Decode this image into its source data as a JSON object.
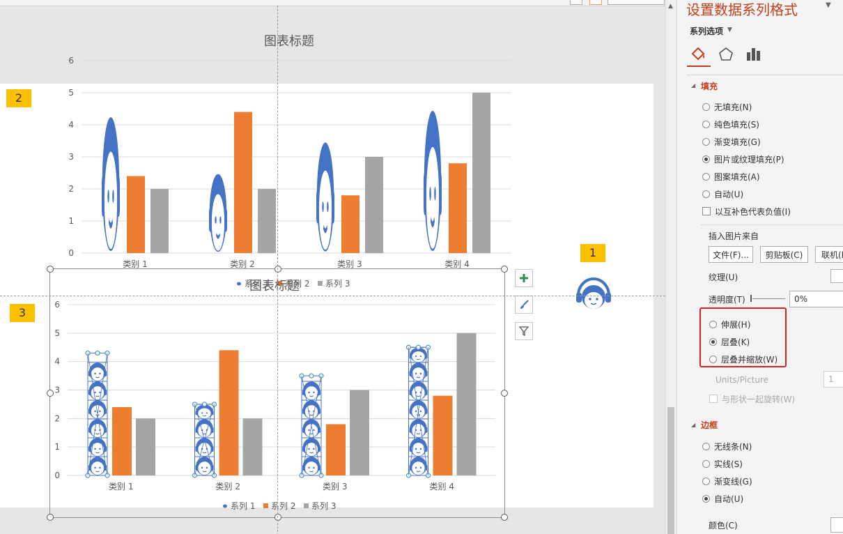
{
  "slide": {
    "tags": [
      "1",
      "2",
      "3"
    ]
  },
  "chart_data": [
    {
      "type": "bar",
      "title": "图表标题",
      "categories": [
        "类别 1",
        "类别 2",
        "类别 3",
        "类别 4"
      ],
      "series": [
        {
          "name": "系列 1",
          "values": [
            4.3,
            2.5,
            3.5,
            4.5
          ],
          "fill": "stretched picture (girl head)"
        },
        {
          "name": "系列 2",
          "values": [
            2.4,
            4.4,
            1.8,
            2.8
          ]
        },
        {
          "name": "系列 3",
          "values": [
            2,
            2,
            3,
            5
          ]
        }
      ],
      "yticks": [
        "0",
        "1",
        "2",
        "3",
        "4",
        "5",
        "6"
      ],
      "ylim": [
        0,
        6
      ],
      "grid": true,
      "legend": "bottom",
      "colors": [
        "#4472c4",
        "#ed7d31",
        "#a5a5a5"
      ]
    },
    {
      "type": "bar",
      "title": "图表标题",
      "categories": [
        "类别 1",
        "类别 2",
        "类别 3",
        "类别 4"
      ],
      "series": [
        {
          "name": "系列 1",
          "values": [
            4.3,
            2.5,
            3.5,
            4.5
          ],
          "fill": "stacked picture (girl head)"
        },
        {
          "name": "系列 2",
          "values": [
            2.4,
            4.4,
            1.8,
            2.8
          ]
        },
        {
          "name": "系列 3",
          "values": [
            2,
            2,
            3,
            5
          ]
        }
      ],
      "yticks": [
        "0",
        "1",
        "2",
        "3",
        "4",
        "5",
        "6"
      ],
      "ylim": [
        0,
        6
      ],
      "grid": true,
      "legend": "bottom",
      "colors": [
        "#4472c4",
        "#ed7d31",
        "#a5a5a5"
      ]
    }
  ],
  "chart_side_buttons": {
    "elements_icon": "plus-icon",
    "styles_icon": "brush-icon",
    "filter_icon": "filter-icon"
  },
  "panel": {
    "title": "设置数据系列格式",
    "series_options": "系列选项",
    "tabs": [
      "fill-line-icon",
      "effects-icon",
      "series-options-icon"
    ],
    "fill": {
      "heading": "填充",
      "options": [
        {
          "label": "无填充(N)",
          "checked": false
        },
        {
          "label": "纯色填充(S)",
          "checked": false
        },
        {
          "label": "渐变填充(G)",
          "checked": false
        },
        {
          "label": "图片或纹理填充(P)",
          "checked": true
        },
        {
          "label": "图案填充(A)",
          "checked": false
        },
        {
          "label": "自动(U)",
          "checked": false
        }
      ],
      "invert_if_negative": "以互补色代表负值(I)",
      "insert_picture_from": "插入图片来自",
      "buttons": [
        "文件(F)...",
        "剪贴板(C)",
        "联机(E)..."
      ],
      "texture_label": "纹理(U)",
      "transparency_label": "透明度(T)",
      "transparency_value": "0%",
      "stretch_options": [
        {
          "label": "伸展(H)",
          "checked": false
        },
        {
          "label": "层叠(K)",
          "checked": true
        },
        {
          "label": "层叠并缩放(W)",
          "checked": false
        }
      ],
      "units_picture_label": "Units/Picture",
      "units_picture_value": "1",
      "rotate_with_shape": "与形状一起旋转(W)"
    },
    "border": {
      "heading": "边框",
      "options": [
        {
          "label": "无线条(N)",
          "checked": false
        },
        {
          "label": "实线(S)",
          "checked": false
        },
        {
          "label": "渐变线(G)",
          "checked": false
        },
        {
          "label": "自动(U)",
          "checked": true
        }
      ],
      "color_label": "颜色(C)"
    }
  },
  "colors": {
    "accent": "#c43e1c",
    "series1": "#4472c4",
    "series2": "#ed7d31",
    "series3": "#a5a5a5",
    "tag": "#fbc000",
    "highlight_box": "#e02020"
  }
}
